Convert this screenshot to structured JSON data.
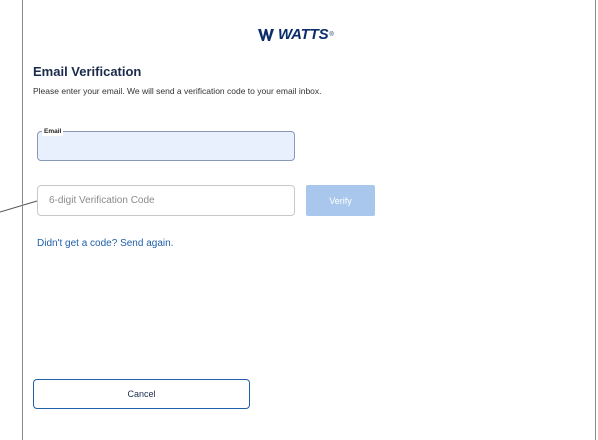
{
  "brand": {
    "logo_text": "WATTS",
    "registered_mark": "®"
  },
  "page": {
    "title": "Email Verification",
    "subtitle": "Please enter your email. We will send a verification code to your email inbox."
  },
  "email": {
    "label": "Email",
    "value": ""
  },
  "code": {
    "placeholder": "6-digit Verification Code",
    "value": ""
  },
  "verify": {
    "label": "Verify"
  },
  "resend": {
    "label": "Didn't get a code? Send again."
  },
  "cancel": {
    "label": "Cancel"
  },
  "colors": {
    "brand_navy": "#0b2d6b",
    "link_blue": "#1f5fa8",
    "verify_disabled": "#a9c7ec",
    "email_autofill_bg": "#e8f0fe"
  }
}
